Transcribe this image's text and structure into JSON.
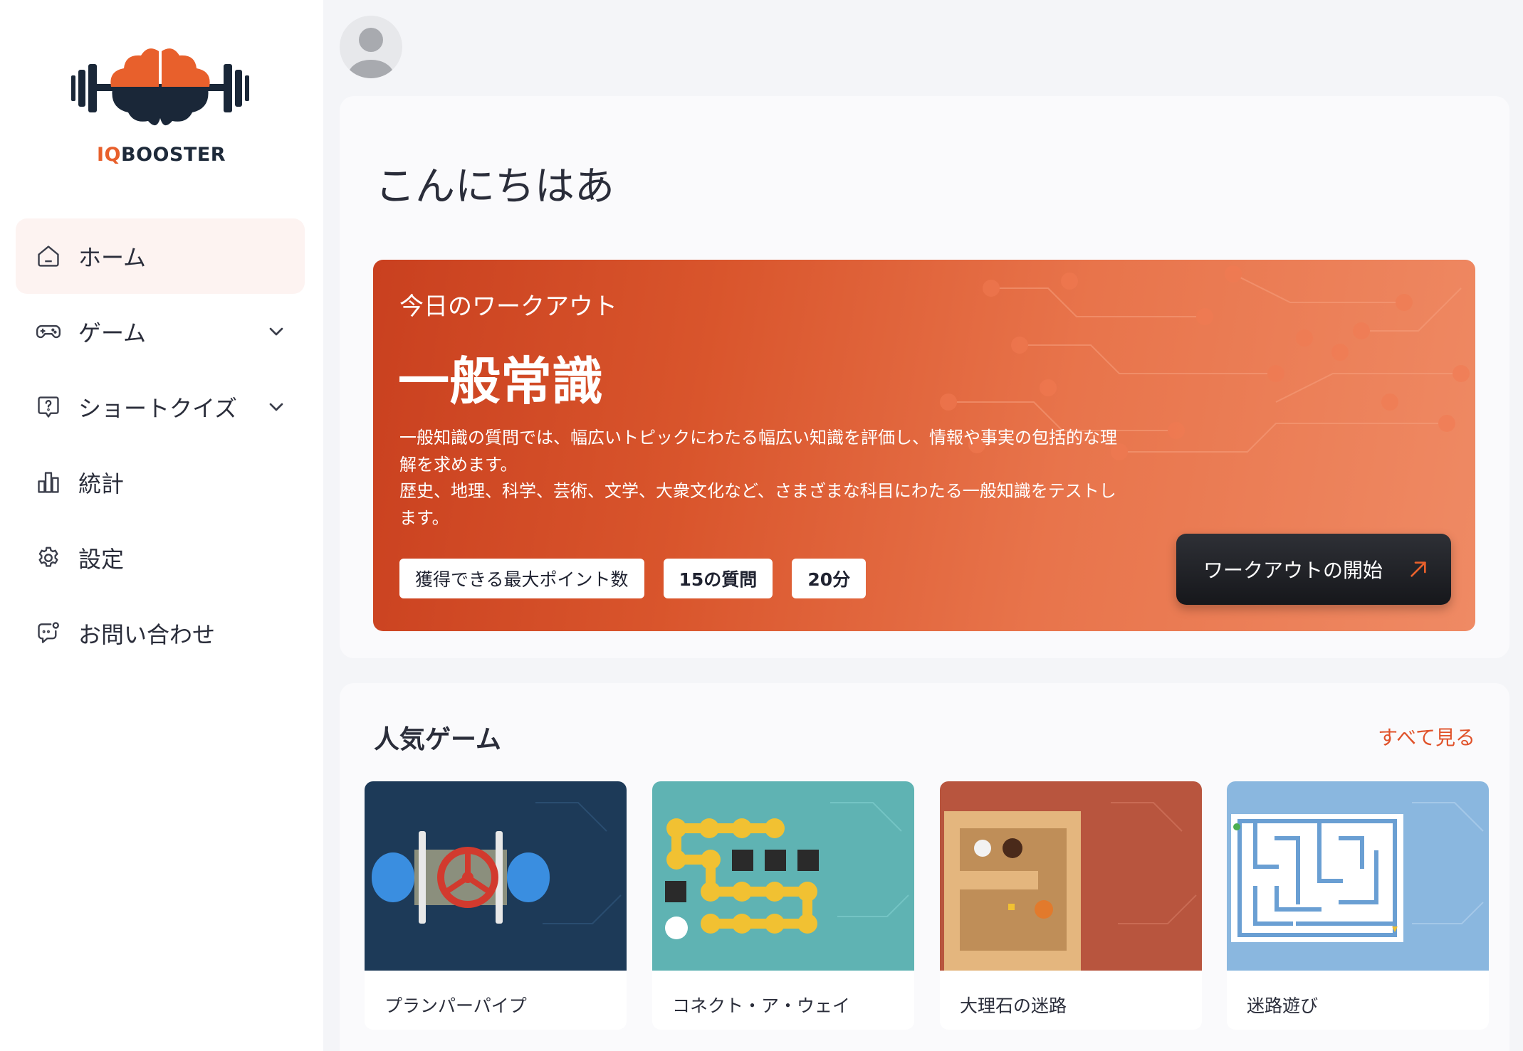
{
  "brand": {
    "logo_prefix": "IQ",
    "logo_suffix": "BOOSTER",
    "accent": "#e8602c"
  },
  "sidebar": {
    "items": [
      {
        "label": "ホーム",
        "icon": "home-icon",
        "active": true
      },
      {
        "label": "ゲーム",
        "icon": "gamepad-icon",
        "expandable": true
      },
      {
        "label": "ショートクイズ",
        "icon": "question-bubble-icon",
        "expandable": true
      },
      {
        "label": "統計",
        "icon": "bar-chart-icon"
      },
      {
        "label": "設定",
        "icon": "gear-icon"
      },
      {
        "label": "お問い合わせ",
        "icon": "chat-icon"
      }
    ]
  },
  "main": {
    "greeting": "こんにちはあ",
    "workout": {
      "subtitle": "今日のワークアウト",
      "title": "一般常識",
      "description_1": "一般知識の質問では、幅広いトピックにわたる幅広い知識を評価し、情報や事実の包括的な理解を求めます。",
      "description_2": "歴史、地理、科学、芸術、文学、大衆文化など、さまざまな科目にわたる一般知識をテストします。",
      "tags": [
        "獲得できる最大ポイント数",
        "15の質問",
        "20分"
      ],
      "start_label": "ワークアウトの開始"
    },
    "games": {
      "title": "人気ゲーム",
      "see_all": "すべて見る",
      "items": [
        {
          "name": "プランパーパイプ",
          "icon": "pipe-valve-icon"
        },
        {
          "name": "コネクト・ア・ウェイ",
          "icon": "connect-dots-icon"
        },
        {
          "name": "大理石の迷路",
          "icon": "marble-maze-icon"
        },
        {
          "name": "迷路遊び",
          "icon": "maze-icon"
        }
      ]
    }
  }
}
